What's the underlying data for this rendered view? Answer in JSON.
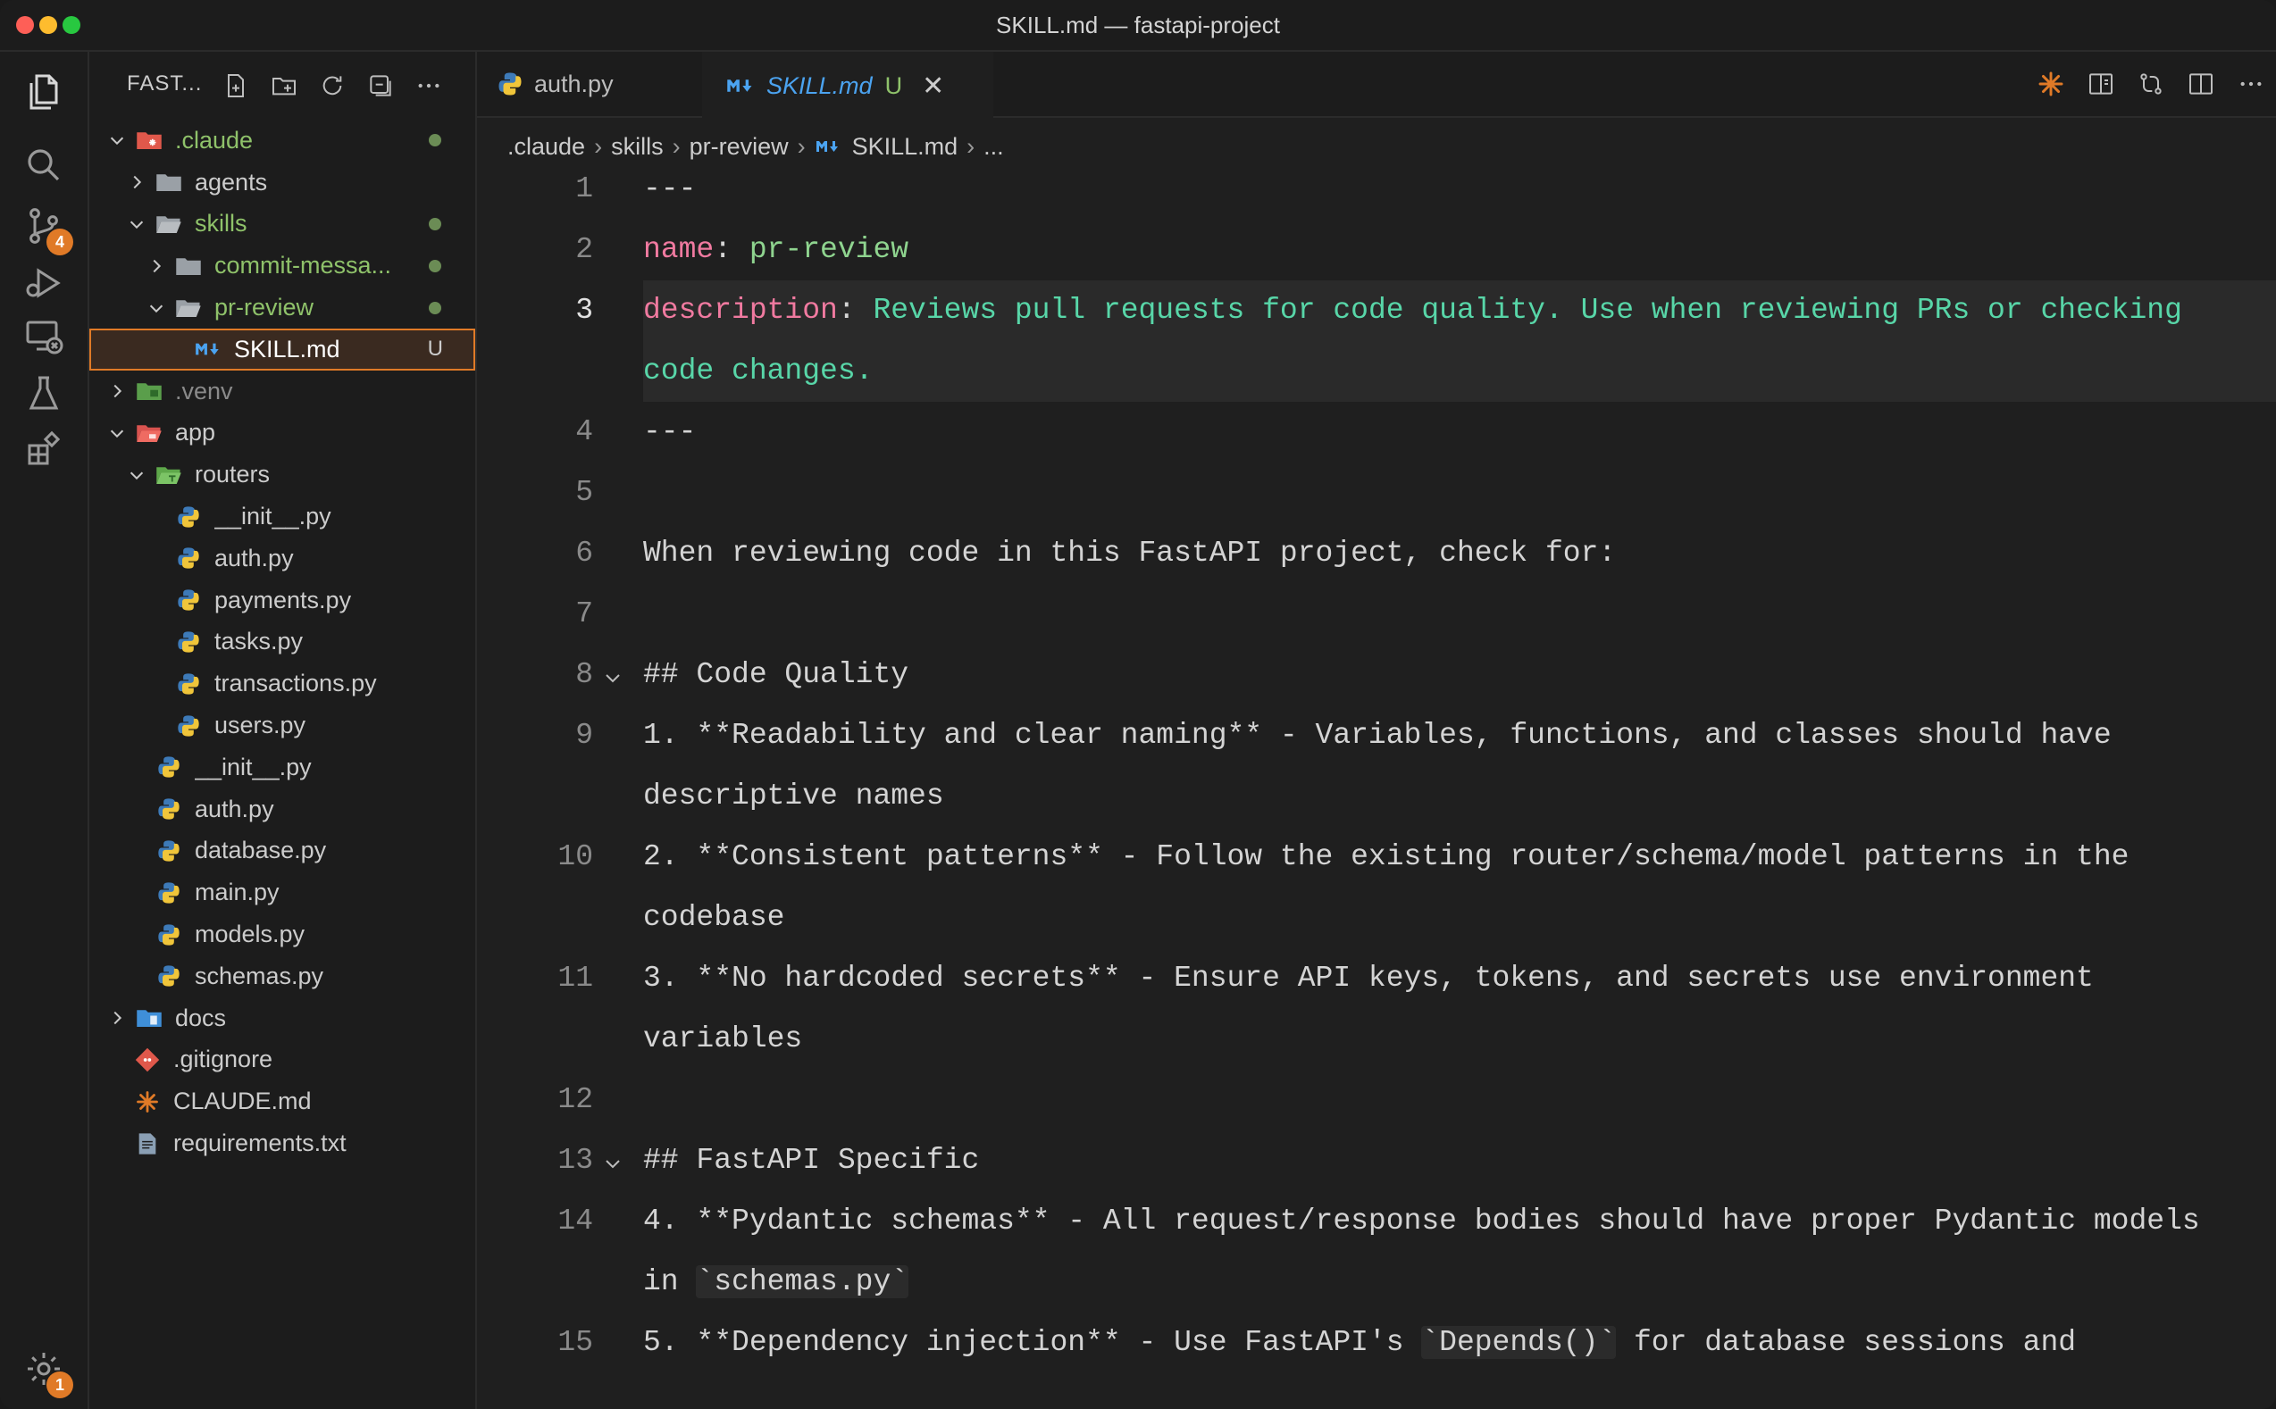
{
  "window": {
    "title": "SKILL.md — fastapi-project"
  },
  "activity_bar": {
    "source_control_badge": "4",
    "settings_badge": "1"
  },
  "explorer": {
    "title": "FAST...",
    "items": [
      {
        "label": ".claude",
        "level": 0,
        "kind": "folder-open",
        "chevron": "down",
        "color": "green",
        "dot": true,
        "icon": "claude-folder-icon"
      },
      {
        "label": "agents",
        "level": 1,
        "kind": "folder",
        "chevron": "right",
        "color": "default",
        "dot": false,
        "icon": "folder-icon"
      },
      {
        "label": "skills",
        "level": 1,
        "kind": "folder-open",
        "chevron": "down",
        "color": "green",
        "dot": true,
        "icon": "folder-open-icon"
      },
      {
        "label": "commit-messa...",
        "level": 2,
        "kind": "folder",
        "chevron": "right",
        "color": "green",
        "dot": true,
        "icon": "folder-icon"
      },
      {
        "label": "pr-review",
        "level": 2,
        "kind": "folder-open",
        "chevron": "down",
        "color": "green",
        "dot": true,
        "icon": "folder-open-icon"
      },
      {
        "label": "SKILL.md",
        "level": 3,
        "kind": "file",
        "chevron": "none",
        "color": "default",
        "dot": false,
        "status": "U",
        "selected": true,
        "icon": "markdown-icon"
      },
      {
        "label": ".venv",
        "level": 0,
        "kind": "folder",
        "chevron": "right",
        "color": "gray",
        "dot": false,
        "icon": "venv-folder-icon"
      },
      {
        "label": "app",
        "level": 0,
        "kind": "folder-open",
        "chevron": "down",
        "color": "default",
        "dot": false,
        "icon": "app-folder-icon"
      },
      {
        "label": "routers",
        "level": 1,
        "kind": "folder-open",
        "chevron": "down",
        "color": "default",
        "dot": false,
        "icon": "routers-folder-icon"
      },
      {
        "label": "__init__.py",
        "level": 2,
        "kind": "file",
        "chevron": "none",
        "color": "default",
        "dot": false,
        "icon": "python-icon"
      },
      {
        "label": "auth.py",
        "level": 2,
        "kind": "file",
        "chevron": "none",
        "color": "default",
        "dot": false,
        "icon": "python-icon"
      },
      {
        "label": "payments.py",
        "level": 2,
        "kind": "file",
        "chevron": "none",
        "color": "default",
        "dot": false,
        "icon": "python-icon"
      },
      {
        "label": "tasks.py",
        "level": 2,
        "kind": "file",
        "chevron": "none",
        "color": "default",
        "dot": false,
        "icon": "python-icon"
      },
      {
        "label": "transactions.py",
        "level": 2,
        "kind": "file",
        "chevron": "none",
        "color": "default",
        "dot": false,
        "icon": "python-icon"
      },
      {
        "label": "users.py",
        "level": 2,
        "kind": "file",
        "chevron": "none",
        "color": "default",
        "dot": false,
        "icon": "python-icon"
      },
      {
        "label": "__init__.py",
        "level": 1,
        "kind": "file",
        "chevron": "none",
        "color": "default",
        "dot": false,
        "icon": "python-icon"
      },
      {
        "label": "auth.py",
        "level": 1,
        "kind": "file",
        "chevron": "none",
        "color": "default",
        "dot": false,
        "icon": "python-icon"
      },
      {
        "label": "database.py",
        "level": 1,
        "kind": "file",
        "chevron": "none",
        "color": "default",
        "dot": false,
        "icon": "python-icon"
      },
      {
        "label": "main.py",
        "level": 1,
        "kind": "file",
        "chevron": "none",
        "color": "default",
        "dot": false,
        "icon": "python-icon"
      },
      {
        "label": "models.py",
        "level": 1,
        "kind": "file",
        "chevron": "none",
        "color": "default",
        "dot": false,
        "icon": "python-icon"
      },
      {
        "label": "schemas.py",
        "level": 1,
        "kind": "file",
        "chevron": "none",
        "color": "default",
        "dot": false,
        "icon": "python-icon"
      },
      {
        "label": "docs",
        "level": 0,
        "kind": "folder",
        "chevron": "right",
        "color": "default",
        "dot": false,
        "icon": "docs-folder-icon"
      },
      {
        "label": ".gitignore",
        "level": 0,
        "kind": "file",
        "chevron": "none",
        "color": "default",
        "dot": false,
        "icon": "git-icon"
      },
      {
        "label": "CLAUDE.md",
        "level": 0,
        "kind": "file",
        "chevron": "none",
        "color": "default",
        "dot": false,
        "icon": "claude-icon"
      },
      {
        "label": "requirements.txt",
        "level": 0,
        "kind": "file",
        "chevron": "none",
        "color": "default",
        "dot": false,
        "icon": "text-file-icon"
      }
    ]
  },
  "tabs": [
    {
      "label": "auth.py",
      "active": false
    },
    {
      "label": "SKILL.md",
      "active": true,
      "status": "U"
    }
  ],
  "breadcrumb": [
    ".claude",
    "skills",
    "pr-review",
    "SKILL.md",
    "..."
  ],
  "code_lines": [
    {
      "n": "1",
      "rows": [
        [
          {
            "t": "---",
            "c": "plain"
          }
        ]
      ]
    },
    {
      "n": "2",
      "rows": [
        [
          {
            "t": "name",
            "c": "key"
          },
          {
            "t": ": ",
            "c": "plain"
          },
          {
            "t": "pr-review",
            "c": "val"
          }
        ]
      ]
    },
    {
      "n": "3",
      "current": true,
      "rows": [
        [
          {
            "t": "description",
            "c": "key"
          },
          {
            "t": ": ",
            "c": "plain"
          },
          {
            "t": "Reviews pull requests for code quality. Use when reviewing PRs or checking",
            "c": "strg"
          }
        ],
        [
          {
            "t": "code changes.",
            "c": "strg"
          }
        ]
      ]
    },
    {
      "n": "4",
      "rows": [
        [
          {
            "t": "---",
            "c": "plain"
          }
        ]
      ]
    },
    {
      "n": "5",
      "rows": [
        [
          {
            "t": "",
            "c": "plain"
          }
        ]
      ]
    },
    {
      "n": "6",
      "rows": [
        [
          {
            "t": "When reviewing code in this FastAPI project, check for:",
            "c": "plain"
          }
        ]
      ]
    },
    {
      "n": "7",
      "rows": [
        [
          {
            "t": "",
            "c": "plain"
          }
        ]
      ]
    },
    {
      "n": "8",
      "fold": true,
      "rows": [
        [
          {
            "t": "## Code Quality",
            "c": "plain"
          }
        ]
      ]
    },
    {
      "n": "9",
      "rows": [
        [
          {
            "t": "1. **Readability and clear naming** - Variables, functions, and classes should have",
            "c": "plain"
          }
        ],
        [
          {
            "t": "descriptive names",
            "c": "plain"
          }
        ]
      ]
    },
    {
      "n": "10",
      "rows": [
        [
          {
            "t": "2. **Consistent patterns** - Follow the existing router/schema/model patterns in the",
            "c": "plain"
          }
        ],
        [
          {
            "t": "codebase",
            "c": "plain"
          }
        ]
      ]
    },
    {
      "n": "11",
      "rows": [
        [
          {
            "t": "3. **No hardcoded secrets** - Ensure API keys, tokens, and secrets use environment",
            "c": "plain"
          }
        ],
        [
          {
            "t": "variables",
            "c": "plain"
          }
        ]
      ]
    },
    {
      "n": "12",
      "rows": [
        [
          {
            "t": "",
            "c": "plain"
          }
        ]
      ]
    },
    {
      "n": "13",
      "fold": true,
      "rows": [
        [
          {
            "t": "## FastAPI Specific",
            "c": "plain"
          }
        ]
      ]
    },
    {
      "n": "14",
      "rows": [
        [
          {
            "t": "4. **Pydantic schemas** - All request/response bodies should have proper Pydantic models",
            "c": "plain"
          }
        ],
        [
          {
            "t": "in ",
            "c": "plain"
          },
          {
            "t": "`schemas.py`",
            "c": "inl"
          }
        ]
      ]
    },
    {
      "n": "15",
      "rows": [
        [
          {
            "t": "5. **Dependency injection** - Use FastAPI's ",
            "c": "plain"
          },
          {
            "t": "`Depends()`",
            "c": "inl"
          },
          {
            "t": " for database sessions and",
            "c": "plain"
          }
        ]
      ]
    }
  ],
  "colors": {
    "accent": "#e07a27",
    "modified_green": "#8fc26a",
    "yaml_key": "#f07aa0",
    "yaml_value": "#58d6a8",
    "markdown_blue": "#4ba3f0"
  }
}
